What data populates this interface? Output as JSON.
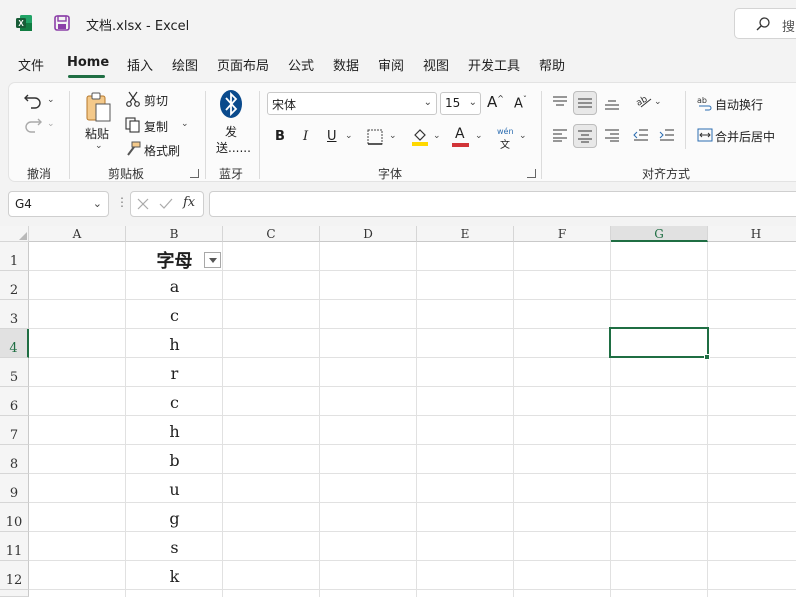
{
  "titlebar": {
    "doc_title": "文档.xlsx  -  Excel",
    "search_text": "搜"
  },
  "menu": {
    "tabs": [
      "文件",
      "Home",
      "插入",
      "绘图",
      "页面布局",
      "公式",
      "数据",
      "审阅",
      "视图",
      "开发工具",
      "帮助"
    ],
    "active": "Home"
  },
  "ribbon": {
    "undo_group": "撤消",
    "clipboard": {
      "paste": "粘贴",
      "cut": "剪切",
      "copy": "复制",
      "format_painter": "格式刷",
      "group": "剪贴板"
    },
    "bluetooth": {
      "send_line1": "发",
      "send_line2": "送......",
      "group": "蓝牙"
    },
    "font": {
      "name": "宋体",
      "size": "15",
      "bold": "B",
      "italic": "I",
      "underline": "U",
      "font_color_letter": "A",
      "phonetic_top": "wén",
      "phonetic_bottom": "文",
      "group": "字体"
    },
    "alignment": {
      "wrap_text": "自动换行",
      "merge_center": "合并后居中",
      "group": "对齐方式"
    }
  },
  "formula_bar": {
    "name_box": "G4",
    "fx": "fx",
    "formula": ""
  },
  "sheet": {
    "columns": [
      "A",
      "B",
      "C",
      "D",
      "E",
      "F",
      "G",
      "H"
    ],
    "rows": [
      "1",
      "2",
      "3",
      "4",
      "5",
      "6",
      "7",
      "8",
      "9",
      "10",
      "11",
      "12"
    ],
    "selected_cell": "G4",
    "column_b": [
      "字母",
      "a",
      "c",
      "h",
      "r",
      "c",
      "h",
      "b",
      "u",
      "g",
      "s",
      "k"
    ]
  },
  "colors": {
    "accent": "#1f6e43",
    "excel_green": "#107c41",
    "save_purple": "#8b3fa8",
    "bluetooth": "#0a4a8c",
    "font_red": "#d13438",
    "highlight_yellow": "#ffd800"
  }
}
